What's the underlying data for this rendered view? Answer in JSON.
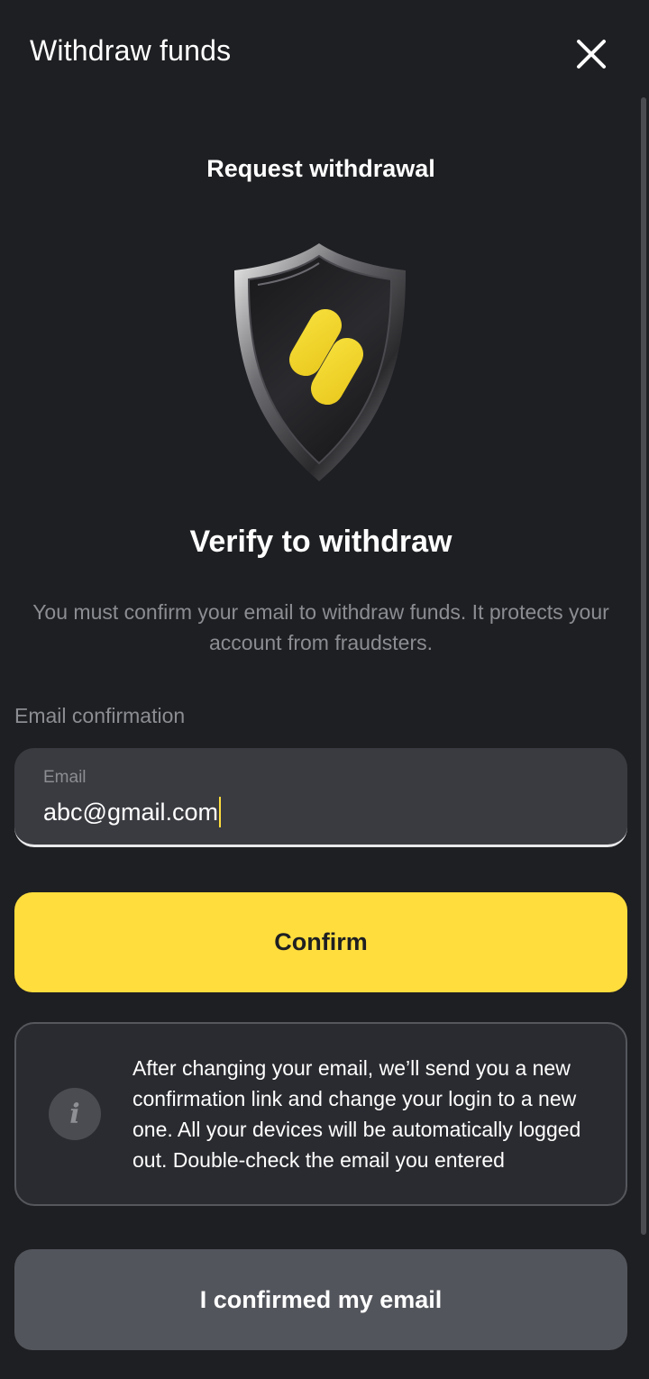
{
  "header": {
    "title": "Withdraw funds",
    "close_icon": "close-icon"
  },
  "page": {
    "subtitle": "Request withdrawal",
    "illustration": "shield-icon",
    "heading": "Verify to withdraw",
    "description": "You must confirm your email to withdraw funds. It protects your account from fraudsters."
  },
  "form": {
    "section_label": "Email confirmation",
    "email_label": "Email",
    "email_value": "abc@gmail.com",
    "confirm_label": "Confirm"
  },
  "info": {
    "icon": "info-icon",
    "icon_glyph": "i",
    "text": "After changing your email, we’ll send you a new confirmation link and change your login to a new one. All your devices will be automatically logged out. Double-check the email you entered"
  },
  "footer": {
    "confirmed_label": "I confirmed my email"
  },
  "colors": {
    "background": "#1e1f22",
    "accent": "#ffdd3d",
    "field_bg": "#3a3b41",
    "secondary_button": "#53555c",
    "muted_text": "#8b8d93"
  }
}
